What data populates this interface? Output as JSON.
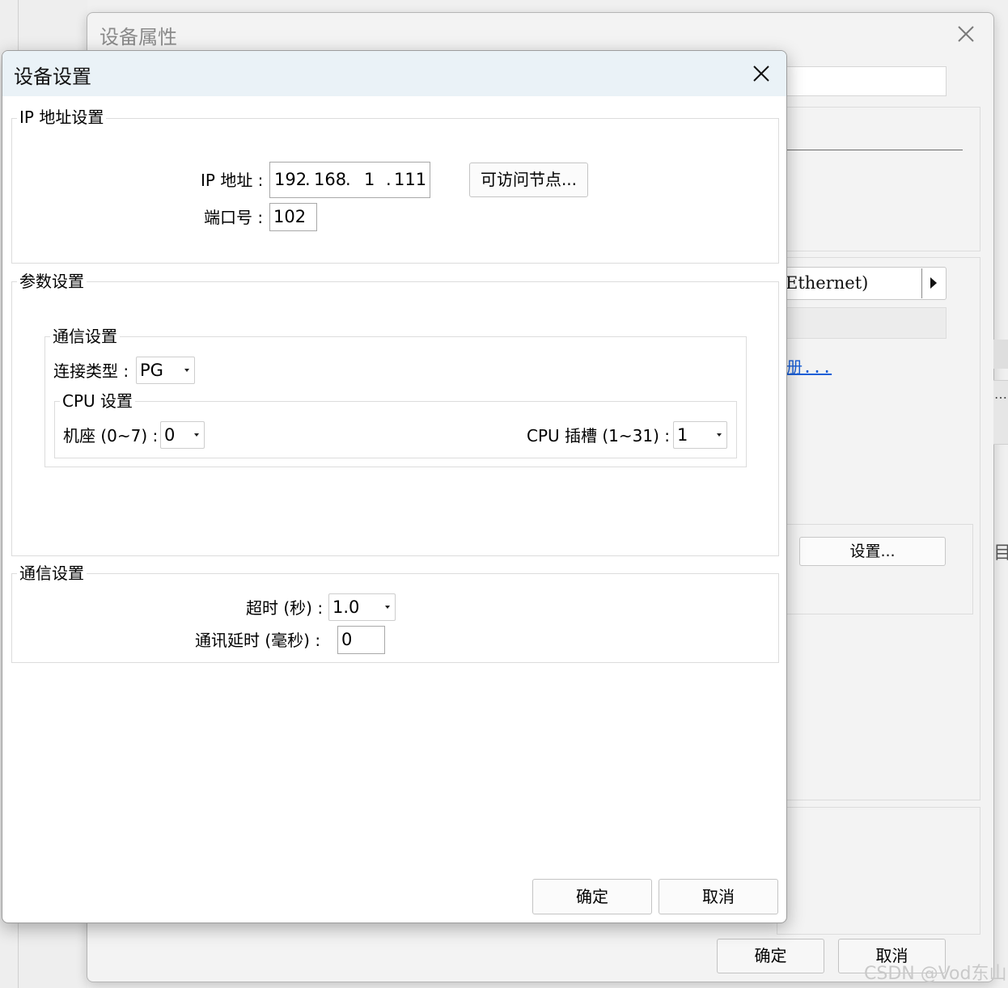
{
  "background_window": {
    "title": "设备属性",
    "combo_text": "Ethernet)",
    "link_text": "册...",
    "settings_button": "设置...",
    "edge_dots": "…",
    "edge_glyph": "目",
    "ok_button": "确定",
    "cancel_button": "取消",
    "watermark": "CSDN @Vod东山"
  },
  "dialog": {
    "title": "设备设置",
    "ip_group": {
      "legend": "IP 地址设置",
      "ip_label": "IP 地址 :",
      "ip_octets": [
        "192",
        "168",
        "1",
        "111"
      ],
      "accessible_nodes_button": "可访问节点...",
      "port_label": "端口号 :",
      "port_value": "102"
    },
    "param_group": {
      "legend": "参数设置",
      "comm_group": {
        "legend": "通信设置",
        "connection_type_label": "连接类型 :",
        "connection_type_value": "PG",
        "cpu_group": {
          "legend": "CPU 设置",
          "rack_label": "机座 (0~7) :",
          "rack_value": "0",
          "slot_label": "CPU 插槽 (1~31) :",
          "slot_value": "1"
        }
      }
    },
    "comm_group": {
      "legend": "通信设置",
      "timeout_label": "超时 (秒) :",
      "timeout_value": "1.0",
      "delay_label": "通讯延时 (毫秒) :",
      "delay_value": "0"
    },
    "ok_button": "确定",
    "cancel_button": "取消"
  },
  "colors": {
    "titlebar": "#eaf2f7",
    "link": "#1a5fd6",
    "window_bg": "#f3f3f3"
  }
}
